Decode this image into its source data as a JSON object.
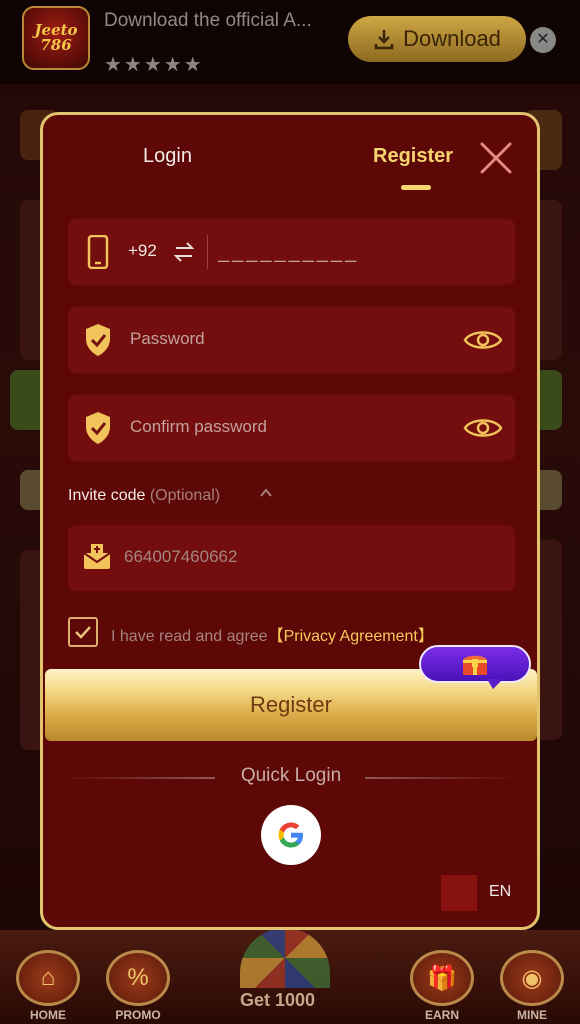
{
  "banner": {
    "logo_text": "Jeeto 786",
    "text": "Download the official A...",
    "stars": "★★★★★",
    "download_label": "Download",
    "close_glyph": "✕"
  },
  "modal": {
    "tab_login": "Login",
    "tab_register": "Register",
    "phone": {
      "code": "+92",
      "placeholder": "__________"
    },
    "password_placeholder": "Password",
    "confirm_placeholder": "Confirm password",
    "invite": {
      "label": "Invite code",
      "optional": "(Optional)",
      "value": "664007460662"
    },
    "agree": {
      "text": "I have read and agree",
      "link": "【Privacy Agreement】"
    },
    "register_button": "Register",
    "quick_login": "Quick Login",
    "lang": "EN"
  },
  "bottom_nav": {
    "home": "HOME",
    "promo": "PROMO",
    "spin": "Get 1000",
    "earn": "EARN",
    "mine": "MINE"
  },
  "colors": {
    "accent": "#f6d46e",
    "modal_bg": "#5d0707",
    "field_bg": "#730d0e"
  }
}
